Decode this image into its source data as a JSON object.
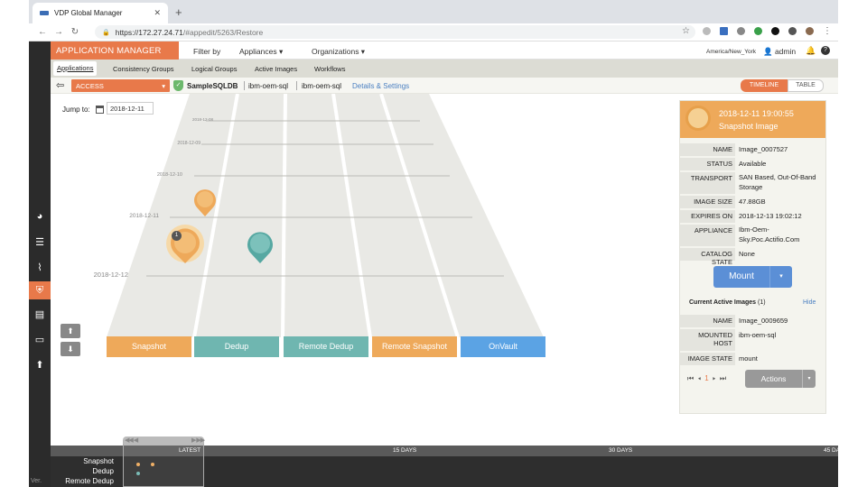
{
  "browser": {
    "tab_title": "VDP Global Manager",
    "url_host": "https://172.27.24.71",
    "url_path": "/#appedit/5263/Restore",
    "close": "✕",
    "new_tab": "+"
  },
  "header": {
    "app_title": "APPLICATION MANAGER",
    "menu": [
      "Filter by",
      "Appliances ▾",
      "Organizations ▾"
    ],
    "timezone": "America/New_York",
    "user": "admin"
  },
  "subnav": {
    "tabs": [
      "Applications",
      "Consistency Groups",
      "Logical Groups",
      "Active Images",
      "Workflows"
    ]
  },
  "breadcrumb": {
    "mode": "ACCESS",
    "app": "SampleSQLDB",
    "host1": "ibm-oem-sql",
    "host2": "ibm-oem-sql",
    "details": "Details & Settings"
  },
  "view_toggle": {
    "timeline": "TIMELINE",
    "table": "TABLE"
  },
  "jump": {
    "label": "Jump to:",
    "value": "2018-12-11"
  },
  "timeline": {
    "dates": [
      "2018-12-08",
      "2018-12-09",
      "2018-12-10",
      "2018-12-11",
      "2018-12-12"
    ],
    "lanes": [
      {
        "name": "Snapshot",
        "color": "#eea95a"
      },
      {
        "name": "Dedup",
        "color": "#6fb6b0"
      },
      {
        "name": "Remote Dedup",
        "color": "#6fb6b0"
      },
      {
        "name": "Remote Snapshot",
        "color": "#eea95a"
      },
      {
        "name": "OnVault",
        "color": "#5ba3e4"
      }
    ],
    "badge": "1"
  },
  "detail": {
    "datetime": "2018-12-11  19:00:55",
    "kind": "Snapshot Image",
    "rows": [
      {
        "key": "NAME",
        "value": "Image_0007527"
      },
      {
        "key": "STATUS",
        "value": "Available"
      },
      {
        "key": "TRANSPORT",
        "value": "SAN Based, Out-Of-Band Storage"
      },
      {
        "key": "IMAGE SIZE",
        "value": "47.88GB"
      },
      {
        "key": "EXPIRES ON",
        "value": "2018-12-13 19:02:12"
      },
      {
        "key": "APPLIANCE",
        "value": "Ibm-Oem-Sky.Poc.Actifio.Com"
      },
      {
        "key": "CATALOG STATE",
        "value": "None"
      }
    ],
    "mount": "Mount",
    "active_images_label": "Current Active Images",
    "active_images_count": "(1)",
    "hide": "Hide",
    "active_rows": [
      {
        "key": "NAME",
        "value": "Image_0009659"
      },
      {
        "key": "MOUNTED HOST",
        "value": "ibm-oem-sql"
      },
      {
        "key": "IMAGE STATE",
        "value": "mount"
      }
    ],
    "page": "1",
    "actions": "Actions"
  },
  "strip": {
    "scale": [
      "LATEST",
      "15 DAYS",
      "30 DAYS",
      "45 DA"
    ],
    "rows": [
      "Snapshot",
      "Dedup",
      "Remote Dedup"
    ]
  },
  "footer": {
    "version": "Ver."
  }
}
